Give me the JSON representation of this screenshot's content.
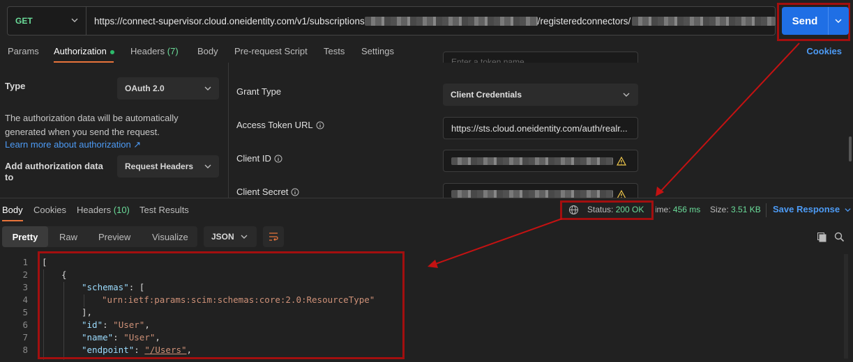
{
  "request": {
    "method": "GET",
    "url_prefix": "https://connect-supervisor.cloud.oneidentity.com/v1/subscriptions",
    "url_middle": "/registeredconnectors/",
    "send_label": "Send"
  },
  "req_tabs": {
    "params": "Params",
    "authorization": "Authorization",
    "headers": "Headers",
    "headers_count": "(7)",
    "body": "Body",
    "prerequest": "Pre-request Script",
    "tests": "Tests",
    "settings": "Settings",
    "cookies": "Cookies"
  },
  "auth": {
    "type_label": "Type",
    "type_value": "OAuth 2.0",
    "description": "The authorization data will be automatically generated when you send the request.",
    "learn_more": "Learn more about authorization ↗",
    "add_label": "Add authorization data to",
    "add_value": "Request Headers",
    "grant_type_label": "Grant Type",
    "grant_type_value": "Client Credentials",
    "token_url_label": "Access Token URL",
    "token_url_value": "https://sts.cloud.oneidentity.com/auth/realr...",
    "client_id_label": "Client ID",
    "client_secret_label": "Client Secret",
    "token_name_placeholder": "Enter a token name..."
  },
  "response": {
    "tabs": {
      "body": "Body",
      "cookies": "Cookies",
      "headers": "Headers",
      "headers_count": "(10)",
      "test_results": "Test Results"
    },
    "status_label": "Status:",
    "status_value": "200 OK",
    "time_label": "Time:",
    "time_value": "456 ms",
    "size_label": "Size:",
    "size_value": "3.51 KB",
    "save_response": "Save Response",
    "view_tabs": [
      "Pretty",
      "Raw",
      "Preview",
      "Visualize"
    ],
    "format": "JSON"
  },
  "code": {
    "line_numbers": [
      "1",
      "2",
      "3",
      "4",
      "5",
      "6",
      "7",
      "8"
    ],
    "l1": "[",
    "l2": "{",
    "l3_key": "\"schemas\"",
    "l3_rest": ": [",
    "l4": "\"urn:ietf:params:scim:schemas:core:2.0:ResourceType\"",
    "l5": "],",
    "l6_key": "\"id\"",
    "l6_val": "\"User\"",
    "l7_key": "\"name\"",
    "l7_val": "\"User\"",
    "l8_key": "\"endpoint\"",
    "l8_val": "\"/Users\""
  },
  "colors": {
    "send": "#1f6fe5",
    "accent": "#e8743b",
    "success": "#6bdd9a",
    "link": "#4d9bf5",
    "annotation": "#a30f0f"
  }
}
